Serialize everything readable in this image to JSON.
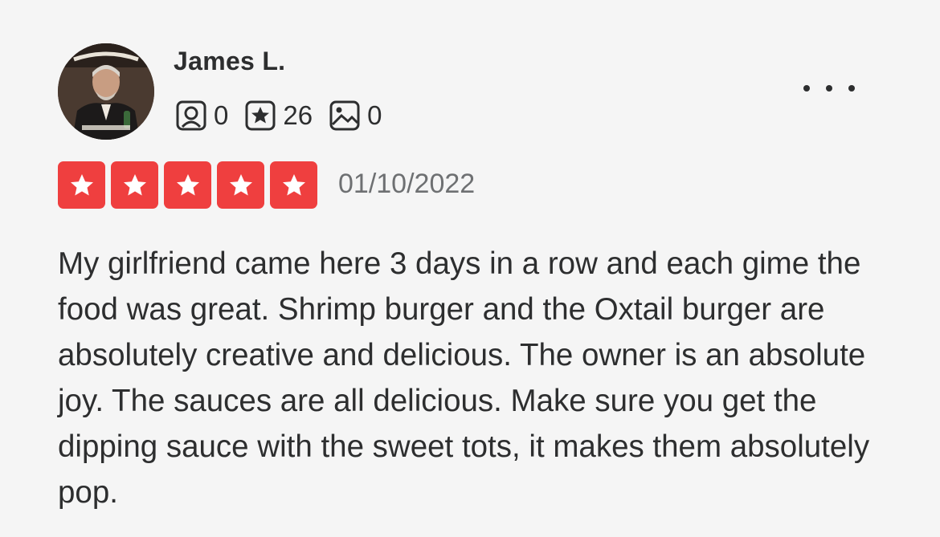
{
  "review": {
    "author": {
      "name": "James L.",
      "avatar_icon": "user-avatar-photo"
    },
    "stats": {
      "friends": "0",
      "reviews": "26",
      "photos": "0"
    },
    "rating": 5,
    "rating_max": 5,
    "star_color": "#ef3f3f",
    "date": "01/10/2022",
    "text": "My girlfriend came here 3 days in a row and each gime the food was great. Shrimp burger and the Oxtail burger are absolutely creative and delicious. The owner is an absolute joy. The sauces are all delicious. Make sure you get the dipping sauce with the sweet tots, it makes them absolutely pop."
  }
}
